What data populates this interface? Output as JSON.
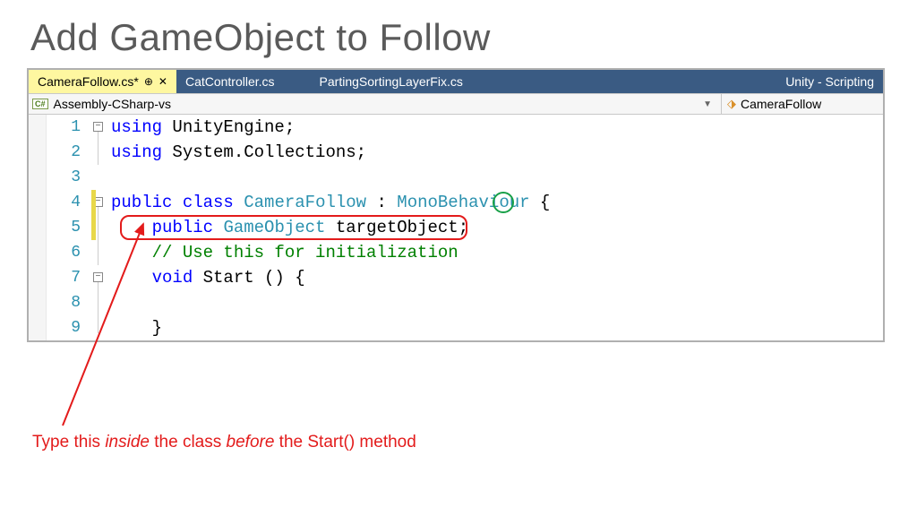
{
  "title": "Add GameObject to Follow",
  "tabs": {
    "active": "CameraFollow.cs*",
    "t1": "CatController.cs",
    "t2": "PartingSortingLayerFix.cs",
    "t3": "Unity - Scripting"
  },
  "nav": {
    "badge": "C#",
    "project": "Assembly-CSharp-vs",
    "type": "CameraFollow"
  },
  "gutter": {
    "l1": "1",
    "l2": "2",
    "l3": "3",
    "l4": "4",
    "l5": "5",
    "l6": "6",
    "l7": "7",
    "l8": "8",
    "l9": "9"
  },
  "code": {
    "l1": {
      "kw": "using",
      "rest": " UnityEngine;"
    },
    "l2": {
      "kw": "using",
      "rest": " System.Collections;"
    },
    "l3": "",
    "l4": {
      "kw1": "public",
      "kw2": "class",
      "name": "CameraFollow",
      "colon": " : ",
      "base": "MonoBehaviour",
      "brace": " {"
    },
    "l5": {
      "indent": "    ",
      "kw": "public",
      "type": "GameObject",
      "rest": " targetObject;"
    },
    "l6": {
      "indent": "    ",
      "comment": "// Use this for initialization"
    },
    "l7": {
      "indent": "    ",
      "kw": "void",
      "rest": " Start () {"
    },
    "l8": "",
    "l9": {
      "indent": "    ",
      "brace": "}"
    }
  },
  "annotation": {
    "p1": "Type this ",
    "p2": "inside",
    "p3": " the class ",
    "p4": "before",
    "p5": " the Start() method"
  }
}
